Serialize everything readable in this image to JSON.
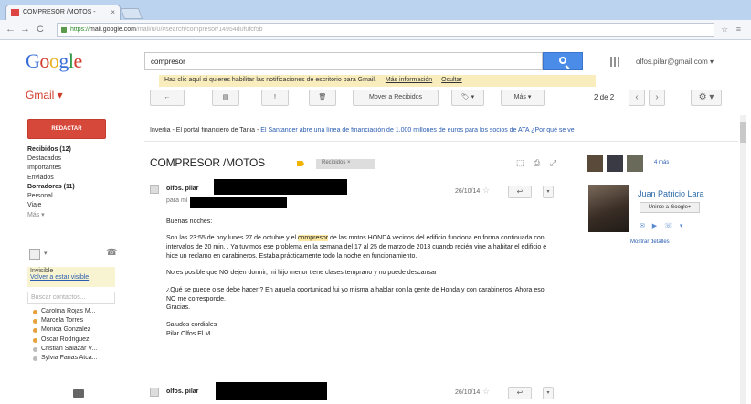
{
  "browser": {
    "tab_title": "COMPRESOR /MOTOS -",
    "tab_close": "×",
    "back": "←",
    "forward": "→",
    "reload": "C",
    "url_scheme": "https://",
    "url_host": "mail.google.com",
    "url_path": "/mail/u/0/#search/compresor/14954d0f0fcf5b",
    "right_icons": "☆ ≡"
  },
  "header": {
    "search_value": "compresor",
    "account": "olfos.pilar@gmail.com ▾",
    "notify_text": "Haz clic aquí si quieres habilitar las notificaciones de escritorio para Gmail.",
    "notify_more": "Más información",
    "notify_hide": "Ocultar"
  },
  "gmail_label": "Gmail ▾",
  "toolbar": {
    "back": "←",
    "archive": "▤",
    "spam": "!",
    "delete": "🗑",
    "move": "Mover a Recibidos",
    "labels": "🏷 ▾",
    "more": "Más ▾",
    "pager": "2 de 2",
    "prev": "‹",
    "next": "›",
    "settings": "⚙ ▾"
  },
  "nav": {
    "compose": "REDACTAR",
    "items": [
      {
        "label": "Recibidos (12)",
        "bold": true
      },
      {
        "label": "Destacados",
        "bold": false
      },
      {
        "label": "Importantes",
        "bold": false
      },
      {
        "label": "Enviados",
        "bold": false
      },
      {
        "label": "Borradores (11)",
        "bold": true
      },
      {
        "label": "Personal",
        "bold": false
      },
      {
        "label": "Viaje",
        "bold": false
      },
      {
        "label": "Más ▾",
        "bold": false
      }
    ]
  },
  "chat": {
    "dropdown": "▾",
    "phone": "☎",
    "invisible_label": "Invisible",
    "invisible_link": "Volver a estar visible",
    "search_placeholder": "Buscar contactos...",
    "contacts": [
      {
        "name": "Carolina Rojas M...",
        "status": "away"
      },
      {
        "name": "Marcela Torres",
        "status": "away"
      },
      {
        "name": "Monica Gonzalez",
        "status": "away"
      },
      {
        "name": "Oscar Rodriguez",
        "status": "away"
      },
      {
        "name": "Cristian Salazar V...",
        "status": "grey"
      },
      {
        "name": "Sylvia Farias Atca...",
        "status": "grey"
      }
    ]
  },
  "ad": {
    "source": "Inverlia - El portal financiero de Tania -",
    "text": "El Santander abre una línea de financiación de 1.000 millones de euros para los socios de ATA",
    "why": "¿Por qué se ve"
  },
  "thread": {
    "subject": "COMPRESOR /MOTOS",
    "label": "Recibidos ×",
    "header_icons": "⬚ ⎙ ⤢"
  },
  "message1": {
    "sender": "olfos. pilar",
    "to": "para mí",
    "date": "26/10/14",
    "reply": "↩",
    "more": "▾",
    "paragraphs": [
      [
        "Buenas noches:"
      ],
      [
        "Son las 23:55 de hoy lunes 27 de octubre y el ",
        "compresor",
        " de las motos HONDA vecinos del edificio funciona en forma continuada con intervalos de 20 min. . Ya tuvimos ese problema en la semana del 17 al 25 de marzo de 2013 cuando recién vine a habitar el edificio e hice un reclamo en carabineros. Estaba prácticamente todo la noche en funcionamiento."
      ],
      [
        "No es posible que NO dejen dormir, mi hijo menor tiene clases temprano y no puede descansar"
      ],
      [
        "¿Qué se puede o se debe hacer ? En aquella oportunidad fui yo misma a hablar con la gente de Honda y con carabineros. Ahora eso NO me corresponde.",
        "Gracias."
      ],
      [
        "Saludos cordiales",
        "Pilar Olfos El M."
      ]
    ]
  },
  "message2": {
    "sender": "olfos. pilar",
    "date": "26/10/14",
    "reply": "↩",
    "more": "▾"
  },
  "contact_card": {
    "more": "4 más",
    "name": "Juan Patricio Lara",
    "join": "Unirse a Google+",
    "icons": "✉ ▶ ☏ ▾",
    "details": "Mostrar detalles"
  }
}
